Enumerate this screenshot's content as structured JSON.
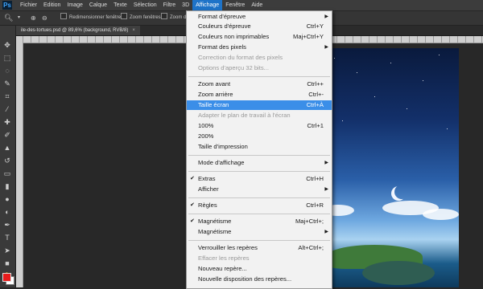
{
  "app": {
    "logo": "Ps"
  },
  "menubar": {
    "items": [
      "Fichier",
      "Edition",
      "Image",
      "Calque",
      "Texte",
      "Sélection",
      "Filtre",
      "3D",
      "Affichage",
      "Fenêtre",
      "Aide"
    ],
    "active": "Affichage"
  },
  "options": {
    "resize_windows": "Redimensionner fenêtres",
    "zoom_windows": "Zoom fenêtres",
    "zoom_drag": "Zoom dé"
  },
  "document_tab": {
    "title": "ile-des-tortues.psd @ 89,6% (background, RVB/8)",
    "close": "×"
  },
  "menu": {
    "format_epreuve": {
      "label": "Format d'épreuve"
    },
    "couleurs_epreuve": {
      "label": "Couleurs d'épreuve",
      "shortcut": "Ctrl+Y"
    },
    "couleurs_non_imprimables": {
      "label": "Couleurs non imprimables",
      "shortcut": "Maj+Ctrl+Y"
    },
    "format_pixels": {
      "label": "Format des pixels"
    },
    "correction_format_pixels": {
      "label": "Correction du format des pixels"
    },
    "options_apercu": {
      "label": "Options d'aperçu 32 bits..."
    },
    "zoom_avant": {
      "label": "Zoom avant",
      "shortcut": "Ctrl++"
    },
    "zoom_arriere": {
      "label": "Zoom arrière",
      "shortcut": "Ctrl+-"
    },
    "taille_ecran": {
      "label": "Taille écran",
      "shortcut": "Ctrl+À"
    },
    "adapter_plan": {
      "label": "Adapter le plan de travail à l'écran"
    },
    "zoom_100": {
      "label": "100%",
      "shortcut": "Ctrl+1"
    },
    "zoom_200": {
      "label": "200%"
    },
    "taille_impression": {
      "label": "Taille d'impression"
    },
    "mode_affichage": {
      "label": "Mode d'affichage"
    },
    "extras": {
      "label": "Extras",
      "shortcut": "Ctrl+H"
    },
    "afficher": {
      "label": "Afficher"
    },
    "regles": {
      "label": "Règles",
      "shortcut": "Ctrl+R"
    },
    "magnetisme": {
      "label": "Magnétisme",
      "shortcut": "Maj+Ctrl+;"
    },
    "magnetisme_sub": {
      "label": "Magnétisme"
    },
    "verrouiller_reperes": {
      "label": "Verrouiller les repères",
      "shortcut": "Alt+Ctrl+;"
    },
    "effacer_reperes": {
      "label": "Effacer les repères"
    },
    "nouveau_repere": {
      "label": "Nouveau repère..."
    },
    "nouvelle_disposition": {
      "label": "Nouvelle disposition des repères..."
    }
  },
  "colors": {
    "foreground": "#e81b1b",
    "background": "#ffffff",
    "highlight": "#3b8ee8"
  }
}
